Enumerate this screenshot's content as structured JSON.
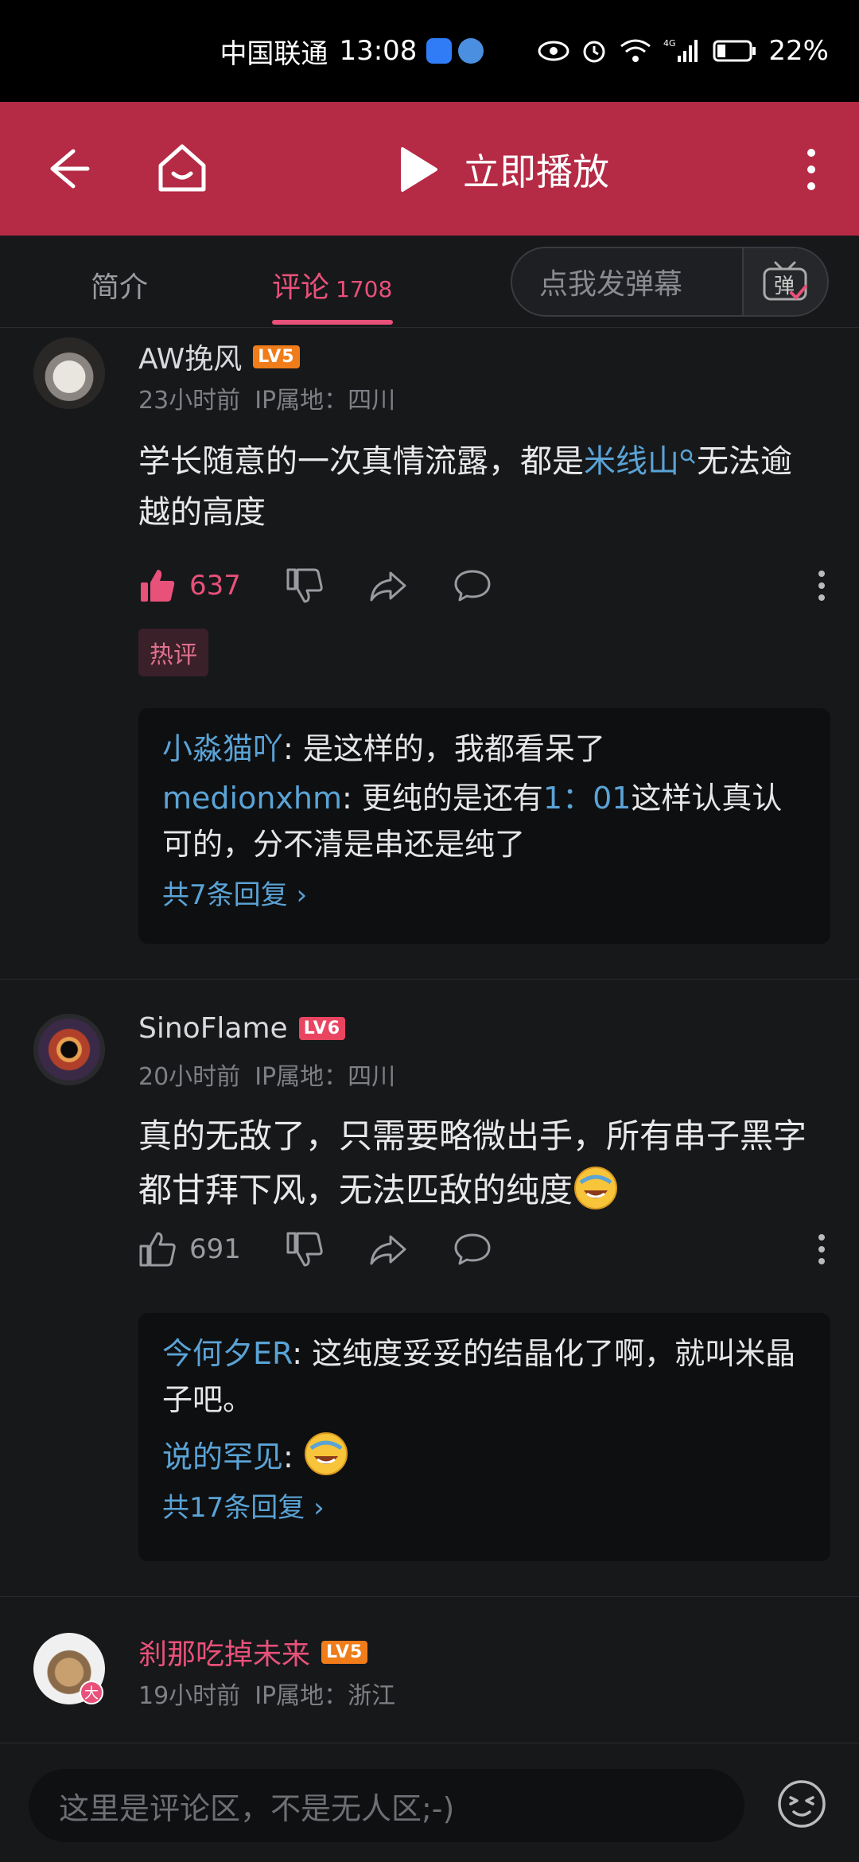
{
  "status_bar": {
    "carrier": "中国联通",
    "time": "13:08",
    "network": "4G",
    "battery": "22%"
  },
  "nav": {
    "play_label": "立即播放",
    "colors": {
      "accent": "#b52a45",
      "pink": "#e8517a",
      "link": "#5aa3d6"
    }
  },
  "tabs": {
    "intro": "简介",
    "comments": "评论",
    "comments_count": "1708",
    "danmaku_placeholder": "点我发弹幕",
    "danmaku_button": "弹"
  },
  "comments": [
    {
      "user": "AW挽风",
      "level": "LV5",
      "time": "23小时前",
      "ip": "IP属地：四川",
      "text_before": "学长随意的一次真情流露，都是",
      "text_link": "米线山",
      "text_after": "无法逾越的高度",
      "likes": "637",
      "tag": "热评",
      "replies": [
        {
          "user": "小淼猫吖",
          "text": ": 是这样的，我都看呆了"
        },
        {
          "user": "medionxhm",
          "text_before": ": 更纯的是还有",
          "link": "1：01",
          "text_after": "这样认真认可的，分不清是串还是纯了"
        }
      ],
      "reply_more": "共7条回复 ›"
    },
    {
      "user": "SinoFlame",
      "level": "LV6",
      "time": "20小时前",
      "ip": "IP属地：四川",
      "text": "真的无敌了，只需要略微出手，所有串子黑字都甘拜下风，无法匹敌的纯度",
      "likes": "691",
      "replies": [
        {
          "user": "今何夕ER",
          "text": ": 这纯度妥妥的结晶化了啊，就叫米晶子吧。"
        },
        {
          "user": "说的罕见",
          "text": ": "
        }
      ],
      "reply_more": "共17条回复 ›"
    },
    {
      "user": "刹那吃掉未来",
      "level": "LV5",
      "time": "19小时前",
      "ip": "IP属地：浙江",
      "avatar_badge": "大"
    }
  ],
  "bottom": {
    "placeholder": "这里是评论区，不是无人区;-)"
  }
}
